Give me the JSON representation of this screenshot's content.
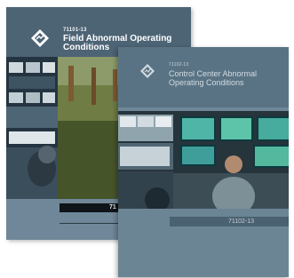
{
  "books": [
    {
      "code": "71101-13",
      "title": "Field Abnormal Operating Conditions",
      "bar_code": "71"
    },
    {
      "code": "71102-13",
      "title": "Control Center Abnormal Operating Conditions",
      "bar_code": "71102-13"
    }
  ],
  "colors": {
    "cover_back": "#6f8798",
    "cover_front": "#6f8899",
    "bar_dark": "#0f1418"
  },
  "icons": {
    "logo": "diamond-emblem-icon"
  }
}
